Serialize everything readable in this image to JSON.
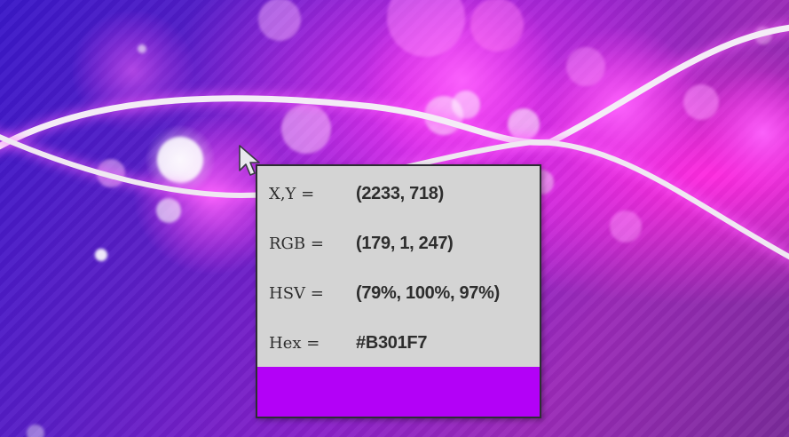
{
  "picker": {
    "rows": [
      {
        "key": "X,Y =",
        "value": "(2233, 718)"
      },
      {
        "key": "RGB =",
        "value": "(179, 1, 247)"
      },
      {
        "key": "HSV =",
        "value": "(79%, 100%, 97%)"
      },
      {
        "key": "Hex =",
        "value": "#B301F7"
      }
    ],
    "swatch_color": "#B301F7"
  },
  "icons": {
    "cursor": "arrow-cursor-icon"
  }
}
